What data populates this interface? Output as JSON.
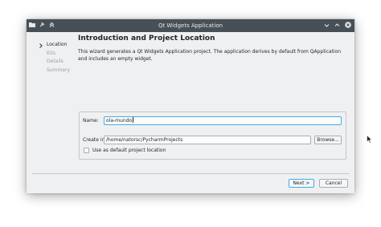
{
  "window": {
    "title": "Qt Widgets Application"
  },
  "sidebar": {
    "steps": [
      {
        "label": "Location",
        "active": true
      },
      {
        "label": "Kits",
        "active": false
      },
      {
        "label": "Details",
        "active": false
      },
      {
        "label": "Summary",
        "active": false
      }
    ]
  },
  "page": {
    "heading": "Introduction and Project Location",
    "description": "This wizard generates a Qt Widgets Application project. The application derives by default from QApplication and includes an empty widget."
  },
  "form": {
    "name_label": "Name:",
    "name_value": "ola-mundo",
    "create_in_label": "Create in:",
    "create_in_value": "/home/natorsc/PycharmProjects",
    "browse_label": "Browse...",
    "default_location_label": "Use as default project location",
    "default_location_checked": false
  },
  "footer": {
    "next_label": "Next >",
    "cancel_label": "Cancel"
  },
  "icons": {
    "titlebar_left": [
      "app-menu-icon",
      "pin-icon",
      "keep-above-icon"
    ],
    "titlebar_right": [
      "minimize-icon",
      "maximize-icon",
      "close-icon"
    ],
    "step_marker": "chevron-right-icon"
  },
  "colors": {
    "titlebar": "#475057",
    "window_bg": "#eff0f1",
    "focus": "#3daee9"
  }
}
